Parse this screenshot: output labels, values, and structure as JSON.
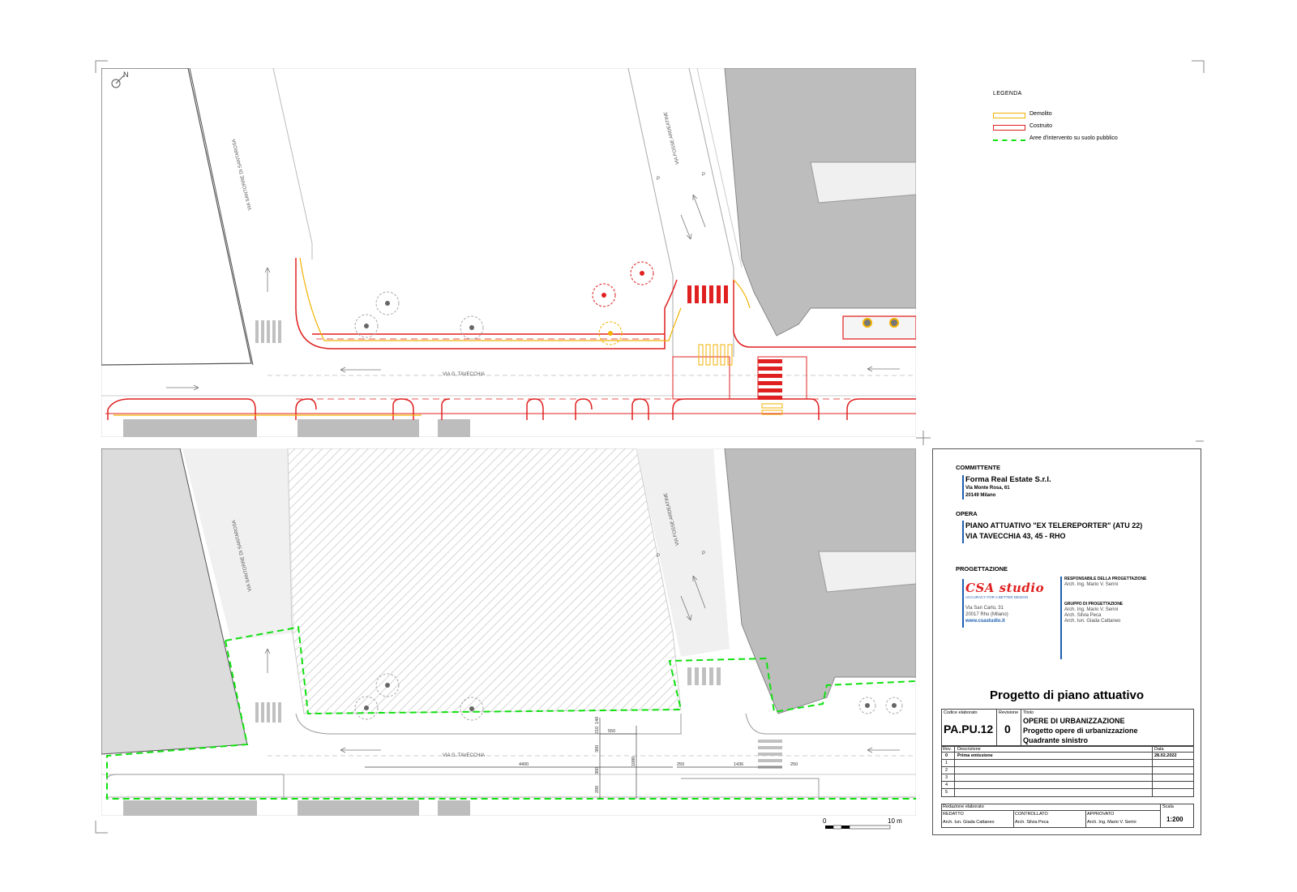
{
  "drawing": {
    "north_arrow": "N",
    "streets": {
      "santorre": "VIA SANTORRE DI SANTAROSA",
      "fosse": "VIA FOSSE ARDEATINE",
      "tavecchia": "VIA G. TAVECCHIA"
    },
    "parking_mark": "P",
    "dimensions": [
      "4400",
      "1436",
      "250",
      "250",
      "550",
      "210",
      "300",
      "300",
      "200",
      "140",
      "1080"
    ],
    "scale_bar": {
      "start": "0",
      "end": "10 m"
    }
  },
  "legend": {
    "title": "LEGENDA",
    "items": [
      {
        "label": "Demolito",
        "color": "#f2b200"
      },
      {
        "label": "Costruito",
        "color": "#e02020"
      },
      {
        "label": "Aree d'intervento su suolo pubblico",
        "color": "#10e010"
      }
    ]
  },
  "title_block": {
    "committente_label": "COMMITTENTE",
    "committente_name": "Forma Real Estate S.r.l.",
    "committente_addr1": "Via Monte Rosa, 61",
    "committente_addr2": "20149 Milano",
    "opera_label": "OPERA",
    "opera_line1": "PIANO ATTUATIVO \"EX TELEREPORTER\" (ATU 22)",
    "opera_line2": "VIA TAVECCHIA 43, 45 - RHO",
    "progettazione_label": "PROGETTAZIONE",
    "logo_text": "CSA studio",
    "logo_tagline": "ACCURACY FOR A BETTER DESIGN",
    "studio_addr1": "Via San Carlo, 31",
    "studio_addr2": "20017 Rho (Milano)",
    "studio_web": "www.csastudio.it",
    "resp_label": "RESPONSABILE DELLA PROGETTAZIONE",
    "resp_name": "Arch. Ing. Mario V. Serini",
    "gruppo_label": "GRUPPO DI PROGETTAZIONE",
    "gruppo": [
      "Arch. Ing. Mario V. Serini",
      "Arch. Silvia Peca",
      "Arch. Iun. Giada Cattaneo"
    ],
    "doc_title": "Progetto di piano attuativo",
    "code_label": "Codice elaborato",
    "code": "PA.PU.12",
    "rev_label": "Revisione",
    "rev": "0",
    "titolo_label": "Titolo",
    "titolo": [
      "OPERE DI URBANIZZAZIONE",
      "Progetto opere di urbanizzazione",
      "Quadrante sinistro"
    ],
    "rev_table": {
      "headers": [
        "Rev.",
        "Descrizione",
        "Data"
      ],
      "rows": [
        [
          "0",
          "Prima emissione",
          "28.02.2022"
        ],
        [
          "1",
          "",
          ""
        ],
        [
          "2",
          "",
          ""
        ],
        [
          "3",
          "",
          ""
        ],
        [
          "4",
          "",
          ""
        ],
        [
          "5",
          "",
          ""
        ]
      ]
    },
    "redazione_label": "Redazione elaborato",
    "redatto_label": "REDATTO",
    "redatto": "Arch. Iun. Giada Cattaneo",
    "controllato_label": "CONTROLLATO",
    "controllato": "Arch. Silvia Peca",
    "approvato_label": "APPROVATO",
    "approvato": "Arch. Ing. Mario V. Serini",
    "scala_label": "Scala",
    "scala": "1:200"
  }
}
